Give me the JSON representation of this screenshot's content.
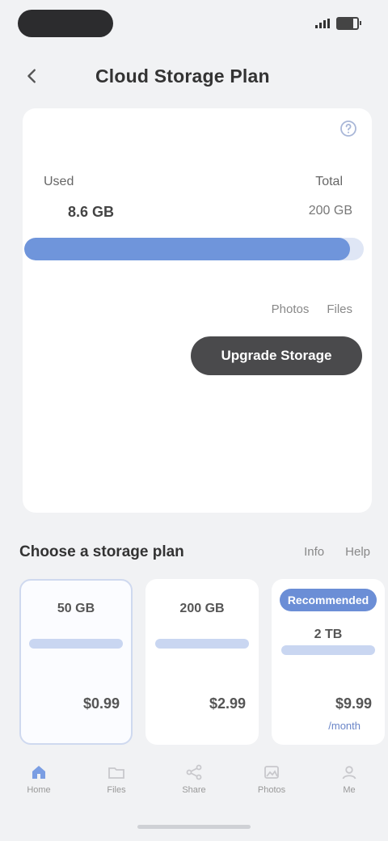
{
  "nav": {
    "title": "Cloud Storage Plan",
    "back_label": "Back"
  },
  "usage": {
    "used_label": "Used",
    "total_label": "Total",
    "used_value": "8.6 GB",
    "total_value": "200 GB",
    "fraction": 0.96,
    "notes": [
      "Photos",
      "Files"
    ],
    "action_label": "Upgrade Storage"
  },
  "plans_section": {
    "title": "Choose a storage plan",
    "links": [
      "Info",
      "Help"
    ],
    "plans": [
      {
        "name": "50 GB",
        "price": "$0.99",
        "sub": "",
        "badge": "",
        "selected": true
      },
      {
        "name": "200 GB",
        "price": "$2.99",
        "sub": "",
        "badge": "",
        "selected": false
      },
      {
        "name": "2 TB",
        "price": "$9.99",
        "sub": "/month",
        "badge": "Recommended",
        "selected": false
      }
    ]
  },
  "tabs": [
    {
      "label": "Home",
      "icon": "home-icon"
    },
    {
      "label": "Files",
      "icon": "folder-icon"
    },
    {
      "label": "Share",
      "icon": "share-icon"
    },
    {
      "label": "Photos",
      "icon": "image-icon"
    },
    {
      "label": "Me",
      "icon": "user-icon"
    }
  ],
  "colors": {
    "accent": "#6f95db",
    "button_dark": "#4a4a4c"
  }
}
